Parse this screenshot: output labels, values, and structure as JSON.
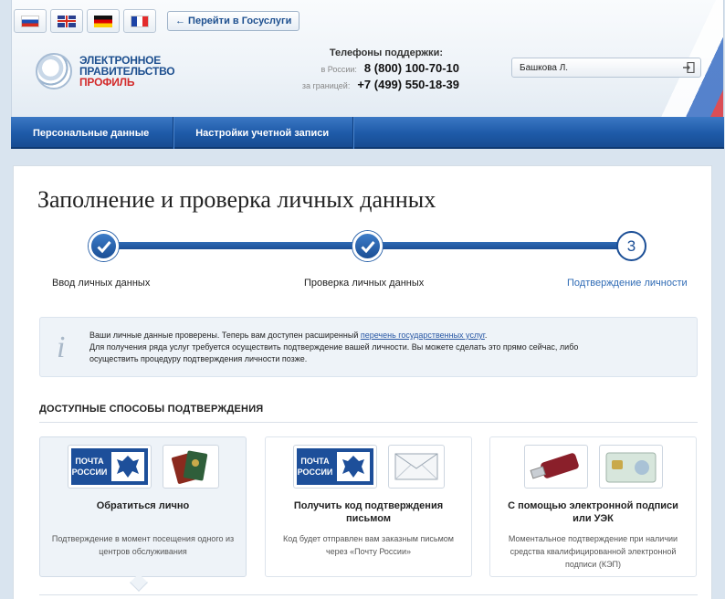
{
  "header": {
    "languages": [
      "Русский",
      "English",
      "Deutsch",
      "Français"
    ],
    "goto_button": "← Перейти в Госуслуги",
    "logo": {
      "line1": "ЭЛЕКТРОННОЕ",
      "line2": "ПРАВИТЕЛЬСТВО",
      "line3": "ПРОФИЛЬ"
    },
    "phones": {
      "title": "Телефоны поддержки:",
      "russia_label": "в России:",
      "russia_number": "8 (800) 100-70-10",
      "abroad_label": "за границей:",
      "abroad_number": "+7 (499) 550-18-39"
    },
    "user_name": "Башкова Л."
  },
  "nav": {
    "items": [
      {
        "label": "Персональные данные"
      },
      {
        "label": "Настройки учетной записи"
      }
    ]
  },
  "main": {
    "title": "Заполнение и проверка личных данных",
    "steps": [
      {
        "label": "Ввод личных данных",
        "state": "done"
      },
      {
        "label": "Проверка личных данных",
        "state": "done"
      },
      {
        "label": "Подтверждение личности",
        "state": "current",
        "number": "3"
      }
    ],
    "info": {
      "line1_prefix": "Ваши личные данные проверены. Теперь вам доступен расширенный ",
      "line1_link": "перечень государственных услуг",
      "line1_suffix": ".",
      "line2": "Для получения ряда услуг требуется осуществить подтверждение вашей личности. Вы можете сделать это прямо сейчас, либо",
      "line3": "осуществить процедуру подтверждения личности позже."
    },
    "section_title": "ДОСТУПНЫЕ СПОСОБЫ ПОДТВЕРЖДЕНИЯ",
    "methods": [
      {
        "title": "Обратиться лично",
        "desc": "Подтверждение в момент посещения одного из центров обслуживания",
        "selected": true
      },
      {
        "title": "Получить код подтверждения письмом",
        "desc": "Код будет отправлен вам заказным письмом через «Почту России»",
        "selected": false
      },
      {
        "title": "С помощью электронной подписи или УЭК",
        "desc": "Моментальное подтверждение при наличии средства квалифицированной электронной подписи (КЭП)",
        "selected": false
      }
    ],
    "post_logo_text": {
      "line1": "ПОЧТА",
      "line2": "РОССИИ"
    }
  },
  "colors": {
    "nav_blue": "#1e5aa8",
    "accent_blue": "#2f6bb5",
    "logo_red": "#d32a2a",
    "info_bg": "#eef3f8"
  }
}
